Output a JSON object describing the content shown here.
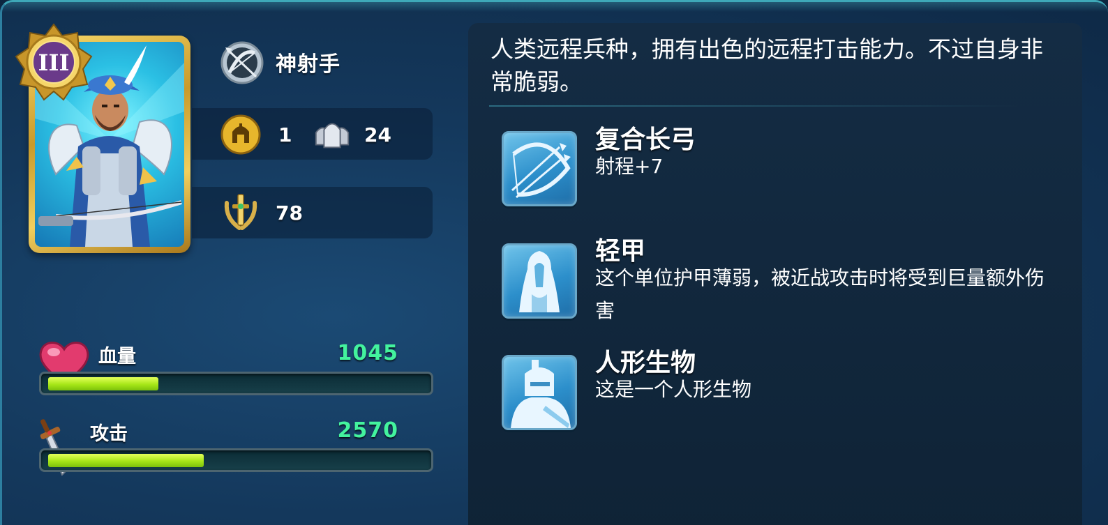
{
  "unit": {
    "rank": "III",
    "type_name": "神射手",
    "type_icon": "crossed-bow-icon",
    "population_icon": "gold-helmet-icon",
    "population": "1",
    "troop_icon": "soldiers-group-icon",
    "troop_count": "24",
    "power_icon": "laurel-sword-icon",
    "power": "78"
  },
  "stats": [
    {
      "label": "血量",
      "value": "1045",
      "icon": "heart-icon",
      "fill_fraction": 0.29
    },
    {
      "label": "攻击",
      "value": "2570",
      "icon": "sword-icon",
      "fill_fraction": 0.41
    }
  ],
  "description": "人类远程兵种，拥有出色的远程打击能力。不过自身非常脆弱。",
  "skills": [
    {
      "title": "复合长弓",
      "desc": "射程+7",
      "icon": "longbow-icon"
    },
    {
      "title": "轻甲",
      "desc": "这个单位护甲薄弱，被近战攻击时将受到巨量额外伤害",
      "icon": "cloak-icon"
    },
    {
      "title": "人形生物",
      "desc": "这是一个人形生物",
      "icon": "humanoid-helmet-icon"
    }
  ],
  "colors": {
    "stat_value": "#43f39e",
    "bar_fill": "#a6e618",
    "card_gold": "#f1cf5e",
    "skill_icon_bg": "#2c8fcb"
  }
}
